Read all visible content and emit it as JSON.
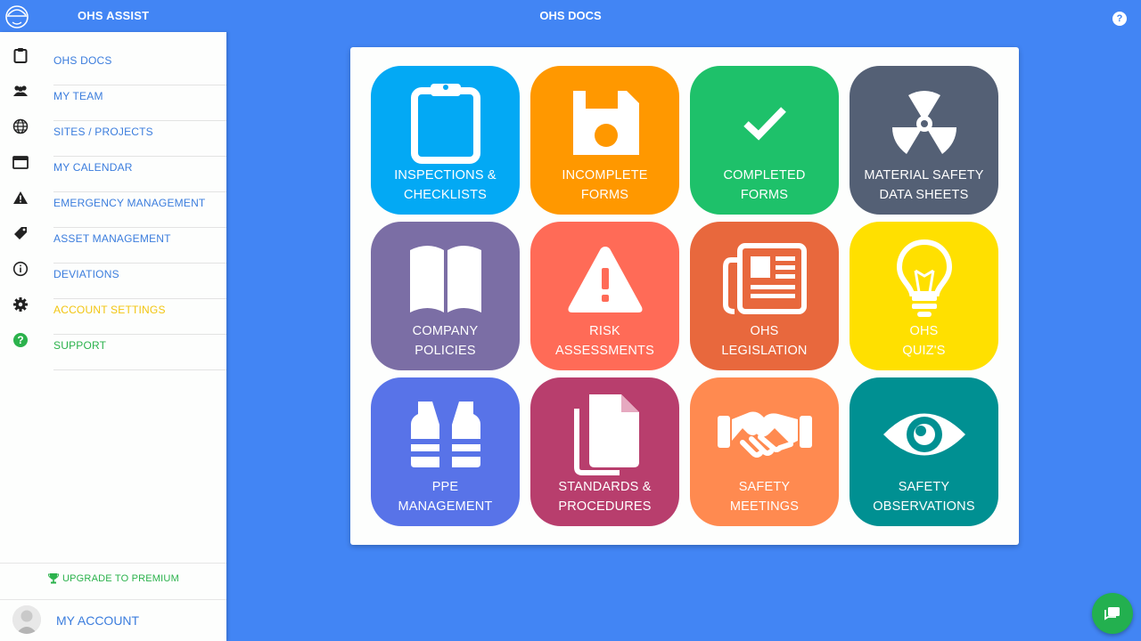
{
  "header": {
    "app_name": "OHS ASSIST",
    "page_title": "OHS DOCS",
    "help_label": "?"
  },
  "sidebar": {
    "items": [
      {
        "label": "OHS DOCS",
        "icon": "clipboard-icon"
      },
      {
        "label": "MY TEAM",
        "icon": "team-icon"
      },
      {
        "label": "SITES / PROJECTS",
        "icon": "globe-icon"
      },
      {
        "label": "MY CALENDAR",
        "icon": "calendar-icon"
      },
      {
        "label": "EMERGENCY MANAGEMENT",
        "icon": "warning-icon"
      },
      {
        "label": "ASSET MANAGEMENT",
        "icon": "tag-icon"
      },
      {
        "label": "DEVIATIONS",
        "icon": "info-icon"
      },
      {
        "label": "ACCOUNT SETTINGS",
        "icon": "gear-icon"
      },
      {
        "label": "SUPPORT",
        "icon": "help-circle-icon"
      }
    ],
    "upgrade_label": "UPGRADE TO PREMIUM",
    "account_label": "MY ACCOUNT"
  },
  "tiles": [
    {
      "line1": "INSPECTIONS &",
      "line2": "CHECKLISTS",
      "color": "#03a9f4",
      "icon": "clipboard-icon"
    },
    {
      "line1": "INCOMPLETE",
      "line2": "FORMS",
      "color": "#ff9800",
      "icon": "floppy-disk-icon"
    },
    {
      "line1": "COMPLETED",
      "line2": "FORMS",
      "color": "#1ec16a",
      "icon": "checkmark-icon"
    },
    {
      "line1": "MATERIAL SAFETY",
      "line2": "DATA SHEETS",
      "color": "#546075",
      "icon": "radiation-icon"
    },
    {
      "line1": "COMPANY",
      "line2": "POLICIES",
      "color": "#7b6ea5",
      "icon": "book-icon"
    },
    {
      "line1": "RISK",
      "line2": "ASSESSMENTS",
      "color": "#ff6b57",
      "icon": "warning-icon"
    },
    {
      "line1": "OHS",
      "line2": "LEGISLATION",
      "color": "#e8683d",
      "icon": "newspaper-icon"
    },
    {
      "line1": "OHS",
      "line2": "QUIZ'S",
      "color": "#ffe000",
      "icon": "lightbulb-icon"
    },
    {
      "line1": "PPE",
      "line2": "MANAGEMENT",
      "color": "#5873e8",
      "icon": "safety-vest-icon"
    },
    {
      "line1": "STANDARDS &",
      "line2": "PROCEDURES",
      "color": "#b83e6d",
      "icon": "documents-icon"
    },
    {
      "line1": "SAFETY",
      "line2": "MEETINGS",
      "color": "#ff8a50",
      "icon": "handshake-icon"
    },
    {
      "line1": "SAFETY",
      "line2": "OBSERVATIONS",
      "color": "#009092",
      "icon": "eye-icon"
    }
  ],
  "colors": {
    "primary": "#4285f4",
    "nav_text": "#3b7ddd",
    "settings_text": "#f2c511",
    "support_text": "#2bb24c",
    "chat_button": "#23b04f"
  }
}
